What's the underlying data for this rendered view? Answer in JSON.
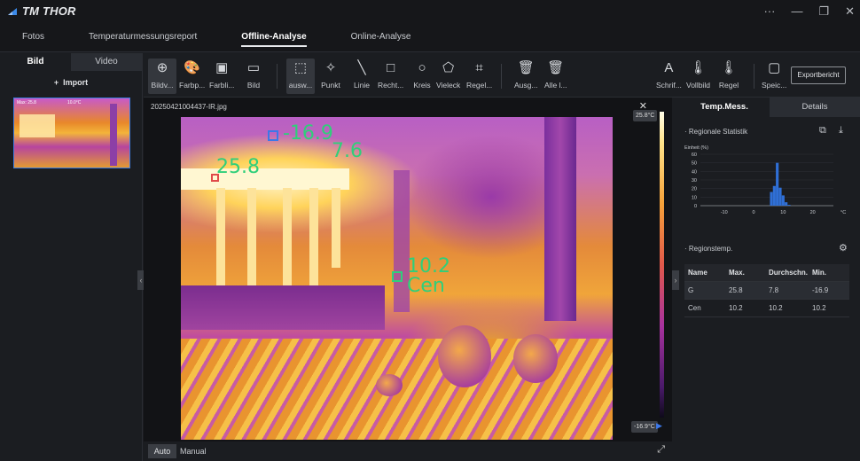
{
  "app": {
    "title": "TM THOR"
  },
  "menu": {
    "items": [
      "Fotos",
      "Temperaturmessungsreport",
      "Offline-Analyse",
      "Online-Analyse"
    ],
    "active": "Offline-Analyse"
  },
  "left": {
    "tabs": [
      "Bild",
      "Video"
    ],
    "import_label": "Import",
    "thumb_text_top": "10.0°C",
    "thumb_text_label": "Max: 25.8"
  },
  "toolbar": {
    "tools": [
      {
        "label": "Bildv...",
        "icon": "zoom-icon"
      },
      {
        "label": "Farbp...",
        "icon": "palette-icon"
      },
      {
        "label": "Farbli...",
        "icon": "color-line-icon"
      },
      {
        "label": "Bild",
        "icon": "image-icon"
      },
      {
        "label": "ausw...",
        "icon": "select-icon"
      },
      {
        "label": "Punkt",
        "icon": "point-icon"
      },
      {
        "label": "Linie",
        "icon": "line-icon"
      },
      {
        "label": "Recht...",
        "icon": "rectangle-icon"
      },
      {
        "label": "Kreis",
        "icon": "circle-icon"
      },
      {
        "label": "Vieleck",
        "icon": "polygon-icon"
      },
      {
        "label": "Regel...",
        "icon": "rule-icon"
      },
      {
        "label": "Ausg...",
        "icon": "delete-icon"
      },
      {
        "label": "Alle l...",
        "icon": "delete-all-icon"
      },
      {
        "label": "Schrif...",
        "icon": "font-icon"
      },
      {
        "label": "Vollbild",
        "icon": "thermometer-icon"
      },
      {
        "label": "Regel",
        "icon": "thermometer-rule-icon"
      },
      {
        "label": "Speic...",
        "icon": "save-icon"
      }
    ],
    "export_label": "Exportbericht"
  },
  "viewer": {
    "filename": "20250421004437-IR.jpg",
    "scale_max": "25.8°C",
    "scale_min": "-16.9°C",
    "overlay_min": "-16.9",
    "overlay_avg": "7.6",
    "overlay_max": "25.8",
    "overlay_center": "10.2",
    "overlay_center_label": "Cen",
    "mode_auto": "Auto",
    "mode_manual": "Manual"
  },
  "right": {
    "tabs": [
      "Temp.Mess.",
      "Details"
    ],
    "stat_title": "· Regionale Statistik",
    "region_title": "· Regionstemp.",
    "table": {
      "headers": [
        "Name",
        "Max.",
        "Durchschn.",
        "Min."
      ],
      "rows": [
        [
          "G",
          "25.8",
          "7.8",
          "-16.9"
        ],
        [
          "Cen",
          "10.2",
          "10.2",
          "10.2"
        ]
      ]
    }
  },
  "chart_data": {
    "type": "bar",
    "ylabel": "Einheit (%)",
    "xlabel": "°C",
    "ylim": [
      0,
      60
    ],
    "yticks": [
      0,
      10,
      20,
      30,
      40,
      50,
      60
    ],
    "xticks": [
      -10,
      0,
      10,
      20
    ],
    "xlim": [
      -18,
      27
    ],
    "bins": [
      {
        "x": 6,
        "value": 16
      },
      {
        "x": 7,
        "value": 23
      },
      {
        "x": 8,
        "value": 50
      },
      {
        "x": 9,
        "value": 21
      },
      {
        "x": 10,
        "value": 12
      },
      {
        "x": 11,
        "value": 4
      },
      {
        "x": 12,
        "value": 1
      }
    ],
    "bar_color": "#2f6fd6"
  }
}
